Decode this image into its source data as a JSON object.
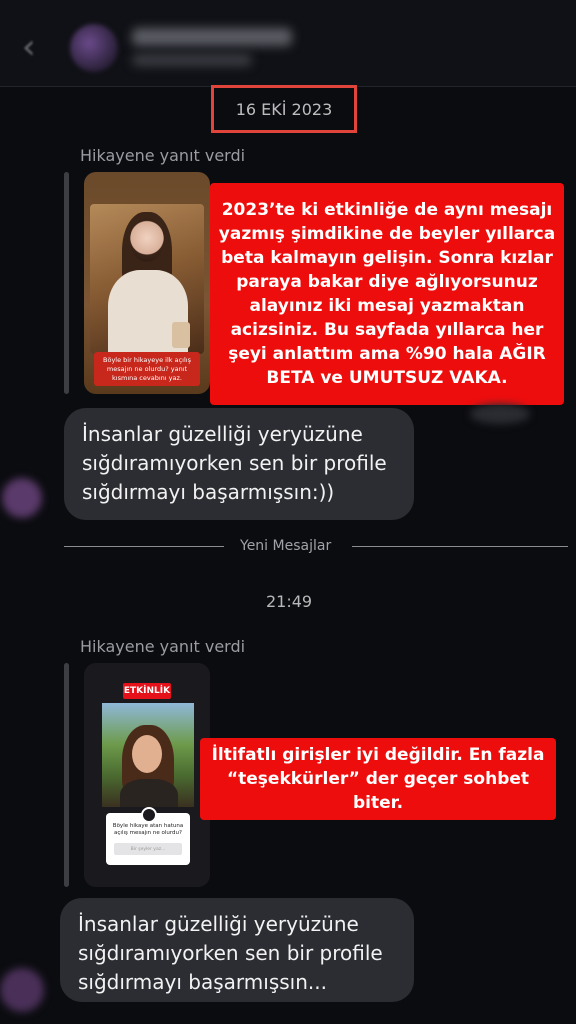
{
  "date_label": "16 EKİ 2023",
  "messages": [
    {
      "reply_label": "Hikayene yanıt verdi",
      "story_caption": "Böyle bir hikayeye ilk açılış mesajın ne olurdu? yanıt kısmına cevabını yaz.",
      "bubble_text": "İnsanlar güzelliği yeryüzüne sığdıramıyorken sen bir profile sığdırmayı başarmışsın:))"
    },
    {
      "reply_label": "Hikayene yanıt verdi",
      "story_badge": "ETKİNLİK",
      "story_question": "Böyle hikaye atan hatuna açılış mesajın ne olurdu?",
      "story_input_placeholder": "Bir şeyler yaz...",
      "bubble_text": "İnsanlar güzelliği yeryüzüne sığdıramıyorken sen bir profile sığdırmayı başarmışsın..."
    }
  ],
  "new_messages_label": "Yeni Mesajlar",
  "time_label": "21:49",
  "annotations": {
    "first": "2023’te ki etkinliğe de aynı mesajı yazmış şimdikine de beyler yıllarca beta kalmayın gelişin. Sonra kızlar paraya bakar diye ağlıyorsunuz alayınız iki mesaj yazmaktan acizsiniz. Bu sayfada yıllarca her şeyi anlattım ama %90 hala AĞIR BETA ve UMUTSUZ VAKA.",
    "second": "İltifatlı girişler iyi değildir. En fazla “teşekkürler” der geçer sohbet biter."
  },
  "colors": {
    "background": "#0b0c10",
    "bubble": "#2c2d33",
    "annotation_red": "#ee0d0d",
    "date_box_border": "#e0443a",
    "badge_red": "#e4111a"
  },
  "icons": {
    "back": "chevron-left-icon"
  }
}
